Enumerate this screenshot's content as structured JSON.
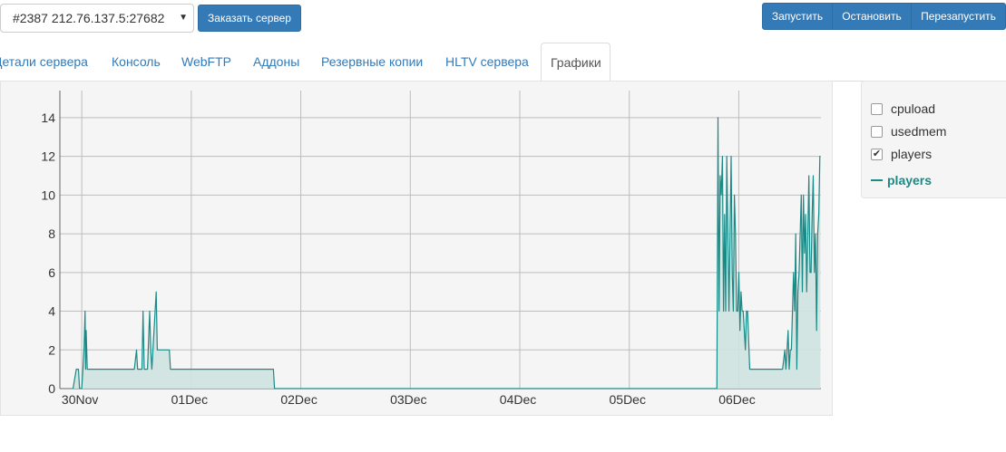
{
  "toolbar": {
    "server_select": "#2387 212.76.137.5:27682",
    "order_button": "Заказать сервер",
    "start_button": "Запустить",
    "stop_button": "Остановить",
    "restart_button": "Перезапустить"
  },
  "tabs": [
    {
      "label": "Детали сервера"
    },
    {
      "label": "Консоль"
    },
    {
      "label": "WebFTP"
    },
    {
      "label": "Аддоны"
    },
    {
      "label": "Резервные копии"
    },
    {
      "label": "HLTV сервера"
    },
    {
      "label": "Графики",
      "active": true
    }
  ],
  "legend": {
    "options": [
      {
        "label": "cpuload",
        "checked": false
      },
      {
        "label": "usedmem",
        "checked": false
      },
      {
        "label": "players",
        "checked": true
      }
    ],
    "series_label": "players"
  },
  "colors": {
    "series_line": "#1a8a87",
    "series_fill": "#cfe3e0",
    "accent": "#337ab7"
  },
  "chart_data": {
    "type": "area",
    "series": [
      {
        "name": "players",
        "x_unit": "days since 30Nov 00:00",
        "points": [
          [
            -0.08,
            0
          ],
          [
            -0.05,
            1
          ],
          [
            -0.03,
            1
          ],
          [
            -0.02,
            0
          ],
          [
            0.0,
            0
          ],
          [
            0.01,
            1
          ],
          [
            0.02,
            2
          ],
          [
            0.03,
            4
          ],
          [
            0.035,
            1
          ],
          [
            0.04,
            3
          ],
          [
            0.05,
            1
          ],
          [
            0.1,
            1
          ],
          [
            0.2,
            1
          ],
          [
            0.3,
            1
          ],
          [
            0.4,
            1
          ],
          [
            0.45,
            1
          ],
          [
            0.48,
            1
          ],
          [
            0.5,
            2
          ],
          [
            0.51,
            1
          ],
          [
            0.55,
            1
          ],
          [
            0.56,
            4
          ],
          [
            0.57,
            1
          ],
          [
            0.6,
            1
          ],
          [
            0.62,
            4
          ],
          [
            0.63,
            2
          ],
          [
            0.64,
            1
          ],
          [
            0.66,
            3
          ],
          [
            0.67,
            4
          ],
          [
            0.68,
            5
          ],
          [
            0.69,
            2
          ],
          [
            0.72,
            2
          ],
          [
            0.8,
            2
          ],
          [
            0.81,
            1
          ],
          [
            0.9,
            1
          ],
          [
            1.0,
            1
          ],
          [
            1.2,
            1
          ],
          [
            1.4,
            1
          ],
          [
            1.6,
            1
          ],
          [
            1.75,
            1
          ],
          [
            1.76,
            0
          ],
          [
            2.0,
            0
          ],
          [
            3.0,
            0
          ],
          [
            4.0,
            0
          ],
          [
            5.0,
            0
          ],
          [
            5.8,
            0
          ],
          [
            5.81,
            14
          ],
          [
            5.82,
            4
          ],
          [
            5.83,
            11
          ],
          [
            5.84,
            10
          ],
          [
            5.85,
            12
          ],
          [
            5.86,
            4
          ],
          [
            5.87,
            9
          ],
          [
            5.88,
            4
          ],
          [
            5.89,
            12
          ],
          [
            5.9,
            8
          ],
          [
            5.91,
            4
          ],
          [
            5.92,
            8
          ],
          [
            5.93,
            12
          ],
          [
            5.94,
            6
          ],
          [
            5.95,
            4
          ],
          [
            5.96,
            10
          ],
          [
            5.97,
            8
          ],
          [
            5.98,
            4
          ],
          [
            5.99,
            4
          ],
          [
            6.0,
            6
          ],
          [
            6.01,
            3
          ],
          [
            6.02,
            5
          ],
          [
            6.03,
            4
          ],
          [
            6.04,
            4
          ],
          [
            6.05,
            3
          ],
          [
            6.06,
            2
          ],
          [
            6.07,
            4
          ],
          [
            6.08,
            4
          ],
          [
            6.1,
            1
          ],
          [
            6.2,
            1
          ],
          [
            6.3,
            1
          ],
          [
            6.4,
            1
          ],
          [
            6.42,
            2
          ],
          [
            6.43,
            1
          ],
          [
            6.44,
            2
          ],
          [
            6.45,
            3
          ],
          [
            6.46,
            1
          ],
          [
            6.47,
            2
          ],
          [
            6.48,
            2
          ],
          [
            6.5,
            6
          ],
          [
            6.51,
            4
          ],
          [
            6.52,
            8
          ],
          [
            6.53,
            1
          ],
          [
            6.54,
            5
          ],
          [
            6.55,
            6
          ],
          [
            6.56,
            8
          ],
          [
            6.57,
            10
          ],
          [
            6.58,
            5
          ],
          [
            6.59,
            10
          ],
          [
            6.6,
            7
          ],
          [
            6.61,
            9
          ],
          [
            6.62,
            5
          ],
          [
            6.63,
            8
          ],
          [
            6.64,
            11
          ],
          [
            6.65,
            6
          ],
          [
            6.66,
            6
          ],
          [
            6.67,
            9
          ],
          [
            6.68,
            11
          ],
          [
            6.69,
            6
          ],
          [
            6.7,
            8
          ],
          [
            6.71,
            3
          ],
          [
            6.72,
            8
          ],
          [
            6.73,
            9
          ],
          [
            6.74,
            12
          ],
          [
            6.745,
            12
          ]
        ]
      }
    ],
    "x_ticks": [
      "30Nov",
      "01Dec",
      "02Dec",
      "03Dec",
      "04Dec",
      "05Dec",
      "06Dec"
    ],
    "y_ticks": [
      0,
      2,
      4,
      6,
      8,
      10,
      12,
      14
    ],
    "xlim": [
      -0.2,
      6.75
    ],
    "ylim": [
      0,
      15.4
    ],
    "grid": true
  }
}
